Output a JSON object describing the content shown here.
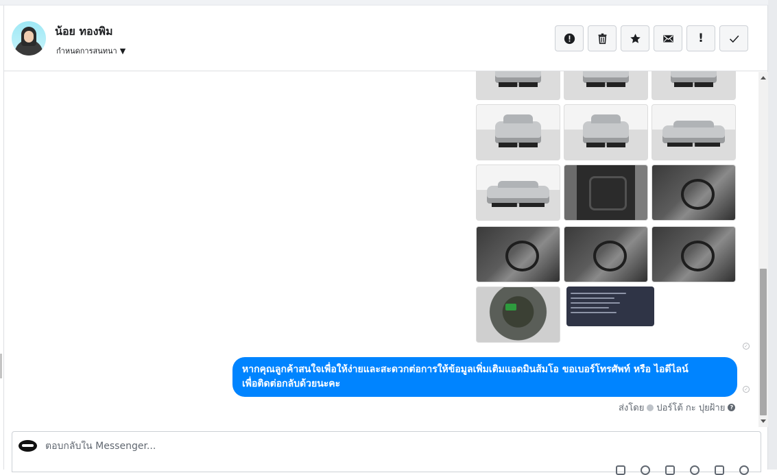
{
  "header": {
    "contact_name": "น้อย ทองพิม",
    "assign_label": "กำหนดการสนทนา",
    "actions": [
      {
        "name": "spam-button",
        "icon": "alert-circle-icon"
      },
      {
        "name": "delete-button",
        "icon": "trash-icon"
      },
      {
        "name": "star-button",
        "icon": "star-icon"
      },
      {
        "name": "unread-button",
        "icon": "envelope-icon"
      },
      {
        "name": "follow-up-button",
        "icon": "exclamation-icon",
        "glyph": "!"
      },
      {
        "name": "done-button",
        "icon": "check-icon"
      }
    ]
  },
  "conversation": {
    "attachments": [
      {
        "kind": "car-front"
      },
      {
        "kind": "car-front"
      },
      {
        "kind": "car-rear"
      },
      {
        "kind": "car-front"
      },
      {
        "kind": "car-rear"
      },
      {
        "kind": "car-side"
      },
      {
        "kind": "car-side"
      },
      {
        "kind": "door-interior"
      },
      {
        "kind": "dashboard"
      },
      {
        "kind": "seats"
      },
      {
        "kind": "dashboard"
      },
      {
        "kind": "seats"
      },
      {
        "kind": "engine"
      },
      {
        "kind": "document"
      }
    ],
    "message_line1": "หากคุณลูกค้าสนใจเพื่อให้ง่ายและสะดวกต่อการให้ข้อมูลเพิ่มเติมแอดมินส้มโอ ขอเบอร์โทรศัพท์ หรือ ไอดีไลน์",
    "message_line2": "เพื่อติดต่อกลับด้วยนะคะ",
    "sent_by_label": "ส่งโดย",
    "sender_name": "ปอร์โต้ กะ ปุยฝ้าย",
    "help_glyph": "?"
  },
  "composer": {
    "placeholder": "ตอบกลับใน Messenger..."
  },
  "colors": {
    "bubble": "#0084ff",
    "panel_border": "#dddfe2"
  }
}
